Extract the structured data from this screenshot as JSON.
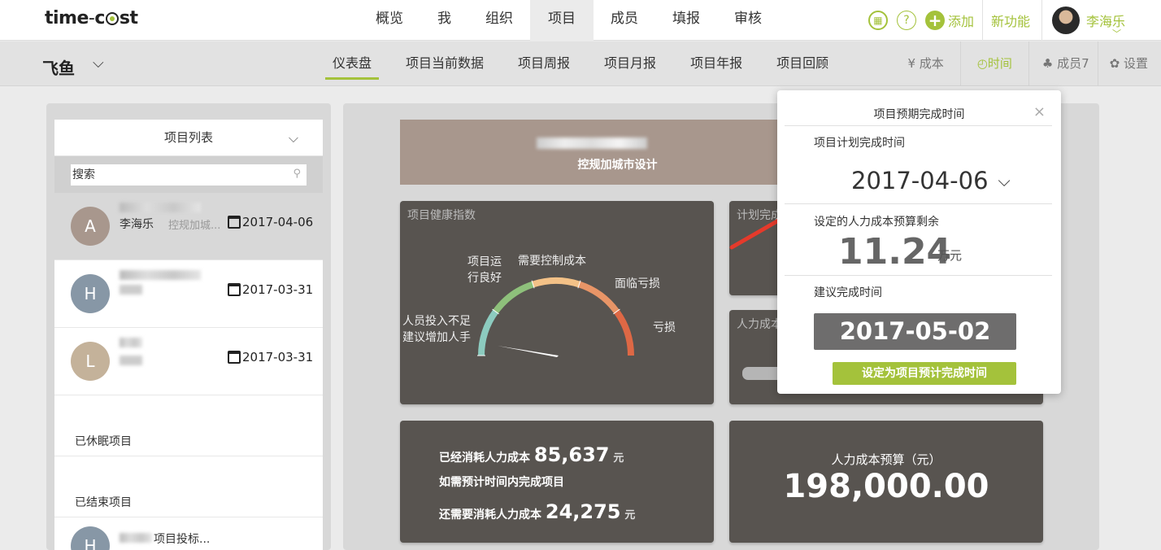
{
  "app": {
    "logo_left": "time",
    "logo_dash": "-",
    "logo_mid": "c",
    "logo_right": "st"
  },
  "topnav": {
    "items": [
      "概览",
      "我",
      "组织",
      "项目",
      "成员",
      "填报",
      "审核"
    ],
    "active": "项目",
    "add_label": "添加",
    "new_feature_label": "新功能",
    "user_name": "李海乐"
  },
  "subnav": {
    "project_name": "飞鱼",
    "tabs": [
      "仪表盘",
      "项目当前数据",
      "项目周报",
      "项目月报",
      "项目年报",
      "项目回顾"
    ],
    "active_tab": "仪表盘",
    "cost_label": "¥ 成本",
    "time_label": "◴时间",
    "members_label": "♣ 成员7",
    "settings_label": "✿ 设置"
  },
  "project_list": {
    "title": "项目列表",
    "search_placeholder": "搜索",
    "rows": [
      {
        "avatar": "A",
        "avatar_color": "#a8978d",
        "owner": "李海乐",
        "desc": "控规加城...",
        "date": "2017-04-06",
        "selected": true
      },
      {
        "avatar": "H",
        "avatar_color": "#8797a6",
        "owner": "",
        "desc": "",
        "date": "2017-03-31",
        "selected": false
      },
      {
        "avatar": "L",
        "avatar_color": "#c4b29a",
        "owner": "",
        "desc": "",
        "date": "2017-03-31",
        "selected": false
      }
    ],
    "dormant_title": "已休眠项目",
    "ended_title": "已结束项目",
    "ended_row": {
      "avatar": "H",
      "avatar_color": "#8797a6",
      "desc": "项目投标..."
    }
  },
  "dashboard": {
    "banner_title": "控规加城市设计",
    "health_title": "项目健康指数",
    "gauge_labels": {
      "insufficient_l1": "人员投入不足",
      "insufficient_l2": "建议增加人手",
      "good_l1": "项目运",
      "good_l2": "行良好",
      "control": "需要控制成本",
      "facing_loss": "面临亏损",
      "loss": "亏损"
    },
    "gauge_colors": [
      "#8ccbbf",
      "#8ec07b",
      "#f3c187",
      "#e89567",
      "#de6845"
    ],
    "plan_title": "计划完成",
    "labor_title": "人力成本",
    "consumed_label": "已经消耗人力成本",
    "consumed_value": "85,637",
    "unit_yuan": "元",
    "plan_finish_label": "如需预计时间内完成项目",
    "still_need_label": "还需要消耗人力成本",
    "still_need_value": "24,275",
    "budget_label": "人力成本预算（元）",
    "budget_value": "198,000.00"
  },
  "popup": {
    "title": "项目预期完成时间",
    "close": "×",
    "plan_label": "项目计划完成时间",
    "plan_date": "2017-04-06",
    "remain_label": "设定的人力成本预算剩余",
    "remain_value": "11.24",
    "remain_unit": "万元",
    "suggest_label": "建议完成时间",
    "suggest_date": "2017-05-02",
    "set_button": "设定为项目预计完成时间"
  }
}
